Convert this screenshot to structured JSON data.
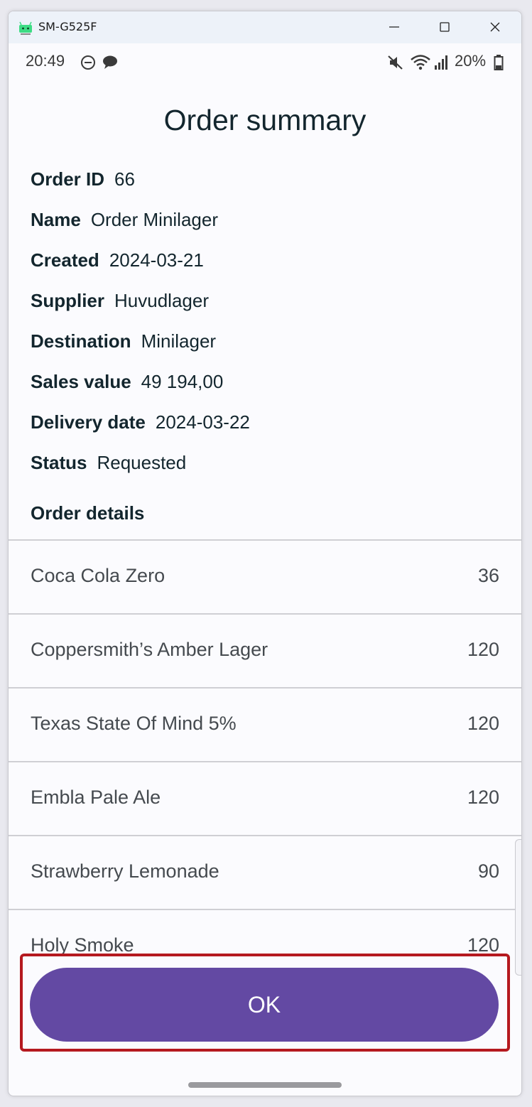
{
  "window": {
    "title": "SM-G525F"
  },
  "status_bar": {
    "time": "20:49",
    "battery": "20%",
    "icons": [
      "do-not-disturb-icon",
      "chat-bubble-icon",
      "mute-icon",
      "wifi-icon",
      "signal-icon",
      "battery-icon"
    ]
  },
  "page": {
    "title": "Order summary",
    "fields": [
      {
        "label": "Order ID",
        "value": "66"
      },
      {
        "label": "Name",
        "value": "Order Minilager"
      },
      {
        "label": "Created",
        "value": "2024-03-21"
      },
      {
        "label": "Supplier",
        "value": "Huvudlager"
      },
      {
        "label": "Destination",
        "value": "Minilager"
      },
      {
        "label": "Sales value",
        "value": "49 194,00"
      },
      {
        "label": "Delivery date",
        "value": "2024-03-22"
      },
      {
        "label": "Status",
        "value": "Requested"
      }
    ],
    "details_heading": "Order details",
    "items": [
      {
        "name": "Coca Cola Zero",
        "qty": "36"
      },
      {
        "name": "Coppersmith’s Amber Lager",
        "qty": "120"
      },
      {
        "name": "Texas State Of Mind 5%",
        "qty": "120"
      },
      {
        "name": "Embla Pale Ale",
        "qty": "120"
      },
      {
        "name": "Strawberry Lemonade",
        "qty": "90"
      },
      {
        "name": "Holy Smoke",
        "qty": "120"
      }
    ],
    "ok_label": "OK"
  },
  "colors": {
    "accent": "#6349a3",
    "highlight": "#b5191f",
    "text": "#13262e"
  }
}
